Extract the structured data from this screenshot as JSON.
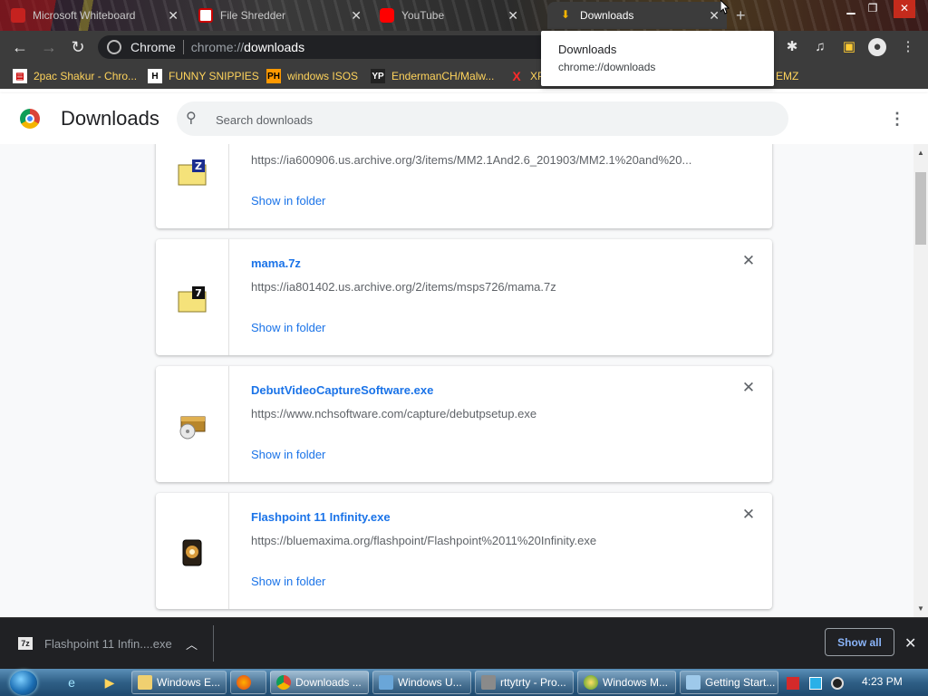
{
  "browser": {
    "tabs": [
      {
        "title": "Microsoft Whiteboard",
        "icon": "gmail-icon",
        "active": false
      },
      {
        "title": "File Shredder",
        "icon": "file-shredder-icon",
        "active": false
      },
      {
        "title": "YouTube",
        "icon": "youtube-icon",
        "active": false
      },
      {
        "title": "Downloads",
        "icon": "download-icon",
        "active": true
      }
    ],
    "new_tab_label": "+",
    "toolbar": {
      "site_label": "Chrome",
      "url_scheme": "chrome://",
      "url_host": "downloads"
    },
    "bookmarks": [
      {
        "label": "2pac Shakur - Chro...",
        "icon": "briefcase-icon"
      },
      {
        "label": "FUNNY SNIPPIES",
        "icon": "h-icon"
      },
      {
        "label": "windows ISOS",
        "icon": "ph-icon"
      },
      {
        "label": "EndermanCH/Malw...",
        "icon": "yp-icon"
      },
      {
        "label": "XP",
        "icon": "x-icon"
      },
      {
        "label": "EMZ",
        "icon": "none"
      }
    ],
    "tooltip": {
      "title": "Downloads",
      "url": "chrome://downloads"
    }
  },
  "page": {
    "title": "Downloads",
    "search_placeholder": "Search downloads"
  },
  "downloads": [
    {
      "name": "",
      "url": "https://ia600906.us.archive.org/3/items/MM2.1And2.6_201903/MM2.1%20and%20...",
      "action": "Show in folder",
      "icon": "7z-archive-icon"
    },
    {
      "name": "mama.7z",
      "url": "https://ia801402.us.archive.org/2/items/msps726/mama.7z",
      "action": "Show in folder",
      "icon": "7z-archive-icon"
    },
    {
      "name": "DebutVideoCaptureSoftware.exe",
      "url": "https://www.nchsoftware.com/capture/debutpsetup.exe",
      "action": "Show in folder",
      "icon": "installer-icon"
    },
    {
      "name": "Flashpoint 11 Infinity.exe",
      "url": "https://bluemaxima.org/flashpoint/Flashpoint%2011%20Infinity.exe",
      "action": "Show in folder",
      "icon": "flashpoint-icon"
    }
  ],
  "shelf": {
    "file_icon_label": "7z",
    "file_name": "Flashpoint 11 Infin....exe",
    "show_all": "Show all"
  },
  "taskbar": {
    "tasks": [
      {
        "label": "Windows E...",
        "icon": "explorer-icon"
      },
      {
        "label": "",
        "icon": "firefox-icon"
      },
      {
        "label": "Downloads ...",
        "icon": "chrome-icon",
        "active": true
      },
      {
        "label": "Windows U...",
        "icon": "windows-update-icon"
      },
      {
        "label": "rttytrty - Pro...",
        "icon": "process-icon"
      },
      {
        "label": "Windows M...",
        "icon": "media-player-icon"
      },
      {
        "label": "Getting Start...",
        "icon": "getting-started-icon"
      }
    ],
    "clock": "4:23 PM"
  },
  "colors": {
    "accent_link": "#1a73e8",
    "shelf_bg": "#202124",
    "bookmark_text": "#ffd45c"
  }
}
